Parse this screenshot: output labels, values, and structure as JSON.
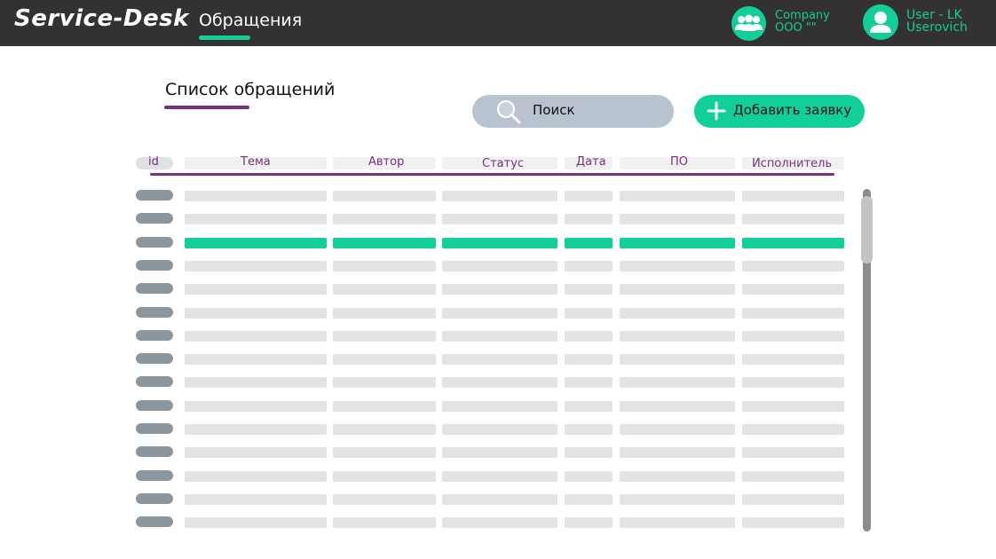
{
  "app": {
    "logo": "Service-Desk",
    "nav_tab": "Обращения",
    "company": {
      "line1": "Company",
      "line2": "OOO \"\""
    },
    "user": {
      "line1": "User - LK",
      "line2": "Userovich"
    },
    "accent_color": "#11cf98",
    "brand_color": "#7a2f7e"
  },
  "page": {
    "title": "Список обращений",
    "search_label": "Поиск",
    "add_button_label": "Добавить заявку"
  },
  "table": {
    "columns": [
      "id",
      "Тема",
      "Автор",
      "Статус",
      "Дата",
      "ПО",
      "Исполнитель"
    ],
    "row_count": 15,
    "selected_row": 3
  },
  "icons": {
    "company": "group-icon",
    "user": "user-icon",
    "search": "search-icon",
    "add": "plus-icon"
  }
}
